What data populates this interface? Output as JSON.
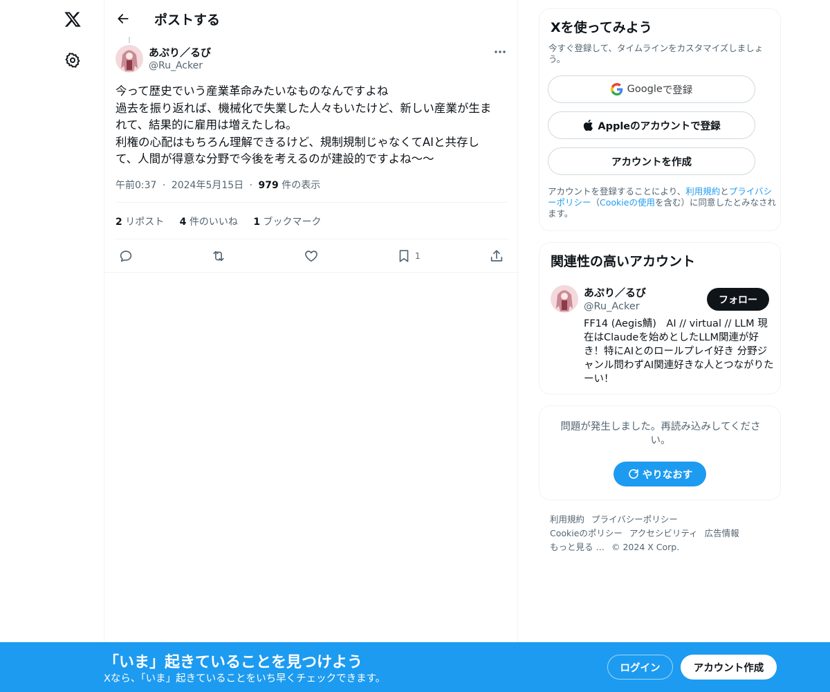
{
  "nav": {
    "logo_icon": "x-logo-icon",
    "settings_icon": "gear-icon"
  },
  "header": {
    "title": "ポストする",
    "back_icon": "arrow-left-icon"
  },
  "post": {
    "author_name": "あぷり／るび",
    "author_handle": "@Ru_Acker",
    "body_lines": [
      "今って歴史でいう産業革命みたいなものなんですよね",
      "過去を振り返れば、機械化で失業した人々もいたけど、新しい産業が生ま",
      "れて、結果的に雇用は増えたしね。",
      "利権の心配はもちろん理解できるけど、規制規制じゃなくてAIと共存し",
      "て、人間が得意な分野で今後を考えるのが建設的ですよね〜〜"
    ],
    "time": "午前0:37",
    "sep1": "·",
    "date": "2024年5月15日",
    "sep2": "·",
    "views_count": "979",
    "views_label": " 件の表示",
    "stats": {
      "reposts_count": "2",
      "reposts_label": " リポスト",
      "likes_count": "4",
      "likes_label": " 件のいいね",
      "bookmarks_count": "1",
      "bookmarks_label": " ブックマーク"
    },
    "actions": {
      "bookmark_count": "1"
    }
  },
  "signup": {
    "title": "Xを使ってみよう",
    "subtitle": "今すぐ登録して、タイムラインをカスタマイズしましょう。",
    "google_brand": "Google",
    "google_label": " で登録",
    "apple_label": "Appleのアカウントで登録",
    "create_label": "アカウントを作成",
    "legal_prefix": "アカウントを登録することにより、",
    "legal_terms": "利用規約",
    "legal_and": "と",
    "legal_privacy": "プライバシーポリシー",
    "legal_mid": "（",
    "legal_cookie": "Cookieの使用",
    "legal_suffix": "を含む）に同意したとみなされます。"
  },
  "related": {
    "title": "関連性の高いアカウント",
    "name": "あぷり／るび",
    "handle": "@Ru_Acker",
    "follow_label": "フォロー",
    "bio": "FF14 (Aegis鯖)　AI // virtual // LLM 現在はClaudeを始めとしたLLM関連が好き！特にAIとのロールプレイ好き 分野ジャンル問わずAI関連好きな人とつながりたーい！"
  },
  "error": {
    "message": "問題が発生しました。再読み込みしてください。",
    "retry_label": "やりなおす"
  },
  "footer": {
    "links": [
      "利用規約",
      "プライバシーポリシー",
      "Cookieのポリシー",
      "アクセシビリティ",
      "広告情報",
      "もっと見る …",
      "© 2024 X Corp."
    ]
  },
  "banner": {
    "title": "「いま」起きていることを見つけよう",
    "subtitle": "Xなら、「いま」起きていることをいち早くチェックできます。",
    "login_label": "ログイン",
    "create_label": "アカウント作成"
  },
  "colors": {
    "accent": "#1d9bf0",
    "text": "#0f1419",
    "muted": "#536471",
    "border": "#eff3f4"
  }
}
